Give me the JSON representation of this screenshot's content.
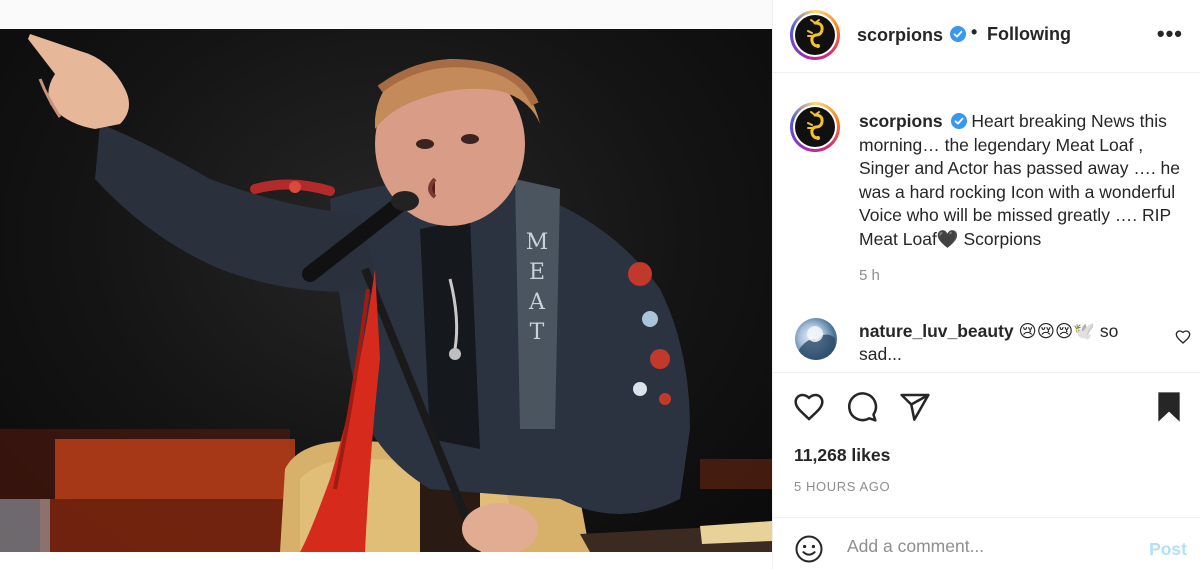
{
  "post": {
    "author": "scorpions",
    "follow_dot": "•",
    "follow_status": "Following",
    "more_label": "•••",
    "caption_text": "Heart breaking News this morning… the legendary Meat Loaf , Singer and Actor has passed away …. he was a hard rocking Icon with a wonderful Voice who will be missed greatly …. RIP Meat Loaf🖤 Scorpions",
    "caption_age": "5 h",
    "photo_strap_text": "MEAT",
    "likes": "11,268 likes",
    "time_ago": "5 HOURS AGO"
  },
  "comments": [
    {
      "username": "nature_luv_beauty",
      "text": "😢😢😢🕊️ so sad..."
    }
  ],
  "composer": {
    "placeholder": "Add a comment...",
    "post_label": "Post"
  },
  "icons": {
    "verified": "verified-badge-icon",
    "more": "more-options-icon",
    "like": "heart-icon",
    "comment": "comment-icon",
    "share": "paper-plane-icon",
    "save": "bookmark-icon",
    "emoji": "emoji-icon",
    "comment_like": "small-heart-icon"
  },
  "colors": {
    "verified_blue": "#3897f0",
    "post_button_disabled": "#b2dffc",
    "muted_text": "#8e8e8e",
    "text": "#262626"
  }
}
